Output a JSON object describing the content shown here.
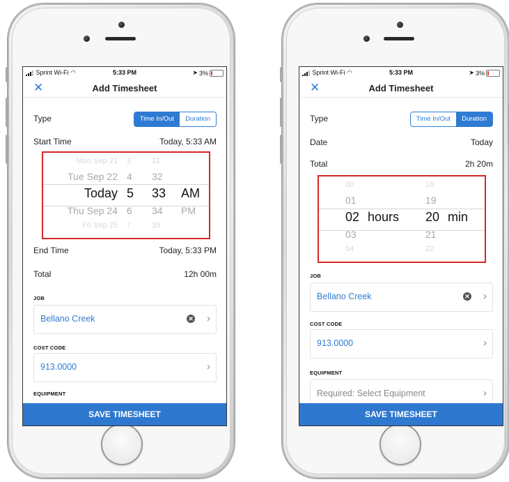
{
  "status": {
    "carrier": "Sprint Wi-Fi",
    "time": "5:33 PM",
    "battery": "3%"
  },
  "nav": {
    "title": "Add Timesheet",
    "close_icon": "close-x-icon"
  },
  "segment": {
    "time_in_out": "Time In/Out",
    "duration": "Duration"
  },
  "left": {
    "type_label": "Type",
    "start_label": "Start Time",
    "start_value": "Today, 5:33 AM",
    "picker": {
      "rows": [
        [
          "Mon Sep 21",
          "3",
          "31",
          ""
        ],
        [
          "Tue Sep 22",
          "4",
          "32",
          ""
        ],
        [
          "Today",
          "5",
          "33",
          "AM"
        ],
        [
          "Thu Sep 24",
          "6",
          "34",
          "PM"
        ],
        [
          "Fri Sep 25",
          "7",
          "35",
          ""
        ]
      ]
    },
    "end_label": "End Time",
    "end_value": "Today, 5:33 PM",
    "total_label": "Total",
    "total_value": "12h 00m",
    "job_header": "JOB",
    "job_value": "Bellano Creek",
    "cost_header": "COST CODE",
    "cost_value": "913.0000",
    "equip_header": "EQUIPMENT",
    "save_label": "SAVE TIMESHEET"
  },
  "right": {
    "type_label": "Type",
    "date_label": "Date",
    "date_value": "Today",
    "total_label": "Total",
    "total_value": "2h 20m",
    "picker": {
      "rows": [
        [
          "00",
          "",
          "18",
          ""
        ],
        [
          "01",
          "",
          "19",
          ""
        ],
        [
          "02",
          "hours",
          "20",
          "min"
        ],
        [
          "03",
          "",
          "21",
          ""
        ],
        [
          "04",
          "",
          "22",
          ""
        ]
      ]
    },
    "job_header": "JOB",
    "job_value": "Bellano Creek",
    "cost_header": "COST CODE",
    "cost_value": "913.0000",
    "equip_header": "EQUIPMENT",
    "equip_placeholder": "Required: Select Equipment",
    "save_label": "SAVE TIMESHEET"
  },
  "colors": {
    "accent": "#2f7bd3",
    "save_bg": "#2f78cf",
    "highlight": "#d42828"
  }
}
